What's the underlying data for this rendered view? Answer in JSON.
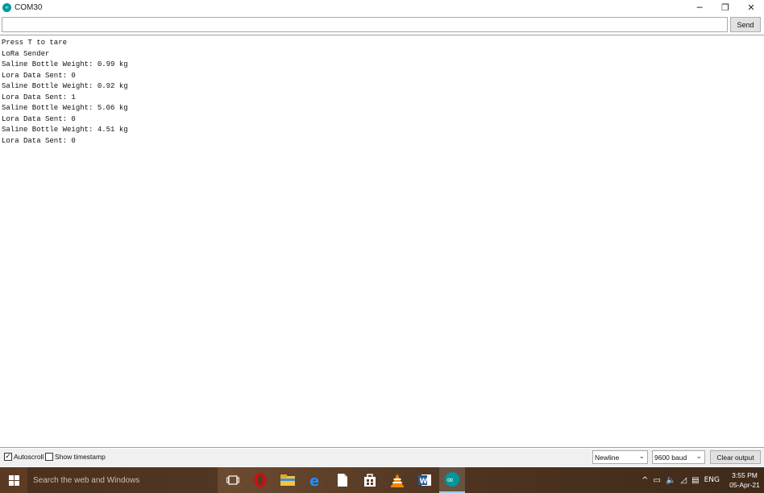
{
  "window": {
    "title": "COM30",
    "icon_glyph": "∞",
    "minimize": "─",
    "restore": "❐",
    "close": "✕"
  },
  "input": {
    "value": "",
    "send_label": "Send"
  },
  "output_lines": [
    "Press T to tare",
    "LoRa Sender",
    "Saline Bottle Weight: 0.99 kg",
    "Lora Data Sent: 0",
    "Saline Bottle Weight: 0.92 kg",
    "Lora Data Sent: 1",
    "Saline Bottle Weight: 5.06 kg",
    "Lora Data Sent: 0",
    "Saline Bottle Weight: 4.51 kg",
    "Lora Data Sent: 0"
  ],
  "status": {
    "autoscroll_label": "Autoscroll",
    "autoscroll_checked": true,
    "timestamp_label": "Show timestamp",
    "timestamp_checked": false,
    "line_ending": "Newline",
    "baud": "9600 baud",
    "clear_label": "Clear output"
  },
  "taskbar": {
    "search_placeholder": "Search the web and Windows",
    "apps": [
      "task-view",
      "opera",
      "file-explorer",
      "edge",
      "notepad",
      "store",
      "vlc",
      "word",
      "arduino"
    ],
    "lang": "ENG",
    "time": "3:55 PM",
    "date": "05-Apr-21"
  },
  "colors": {
    "arduino_teal": "#00979c",
    "opera_red": "#cc0f16",
    "word_blue": "#2b579a",
    "edge_blue": "#0078d7",
    "vlc_orange": "#f08a00"
  }
}
